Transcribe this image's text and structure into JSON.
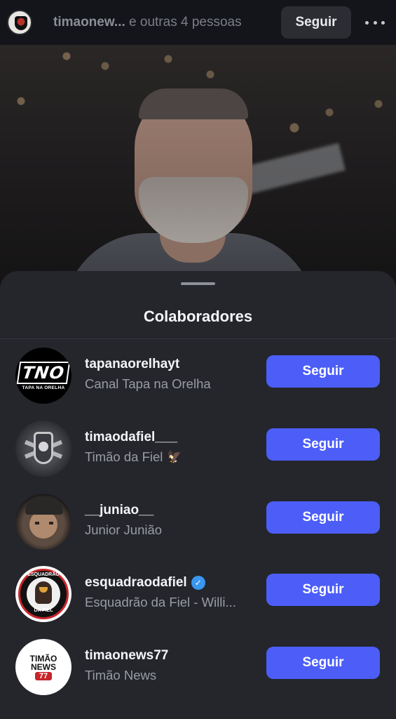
{
  "header": {
    "title_name": "timaonew...",
    "title_rest": " e outras 4 pessoas",
    "follow_label": "Seguir",
    "more_icon": "more-horizontal-icon"
  },
  "sheet": {
    "title": "Colaboradores",
    "collaborators": [
      {
        "username": "tapanaorelhayt",
        "fullname": "Canal Tapa na Orelha",
        "button": "Seguir",
        "avatar_text": "TNO",
        "avatar_subtext": "TAPA NA ORELHA"
      },
      {
        "username": "timaodafiel___",
        "fullname": "Timão da Fiel",
        "fullname_emoji": "🦅",
        "button": "Seguir"
      },
      {
        "username": "__juniao__",
        "fullname": "Junior Junião",
        "button": "Seguir"
      },
      {
        "username": "esquadraodafiel",
        "fullname": "Esquadrão da Fiel - Willi...",
        "button": "Seguir",
        "verified": true,
        "avatar_text_top": "ESQUADRÃO",
        "avatar_text_bottom": "DA FIEL"
      },
      {
        "username": "timaonews77",
        "fullname": "Timão News",
        "button": "Seguir",
        "avatar_lines": [
          "TIMÃO",
          "NEWS",
          "77"
        ]
      }
    ]
  },
  "colors": {
    "follow_button": "#4c5ef7",
    "sheet_bg": "#24262c",
    "verified": "#3897f0"
  }
}
